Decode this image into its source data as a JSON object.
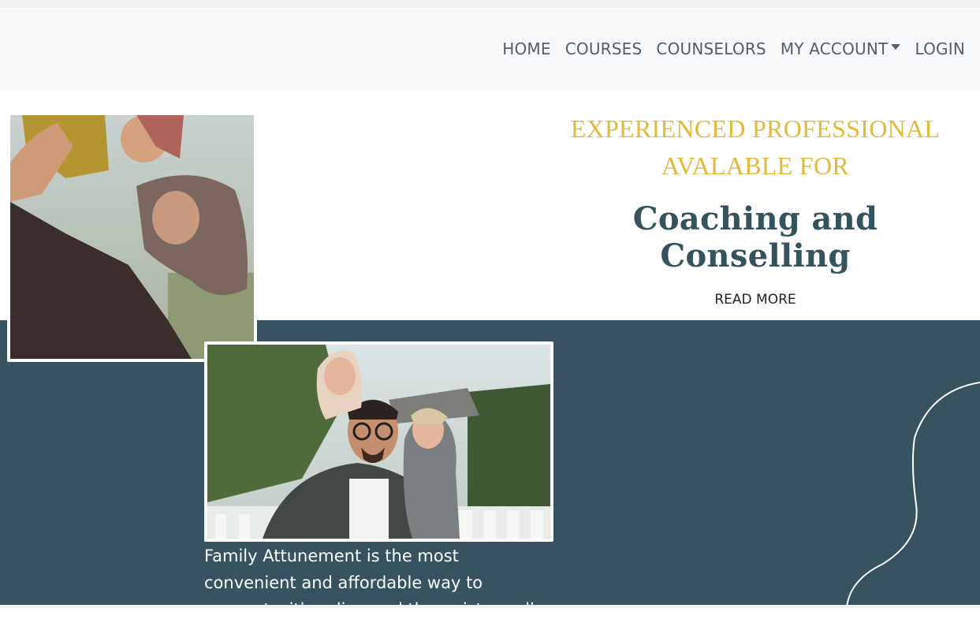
{
  "nav": {
    "items": [
      {
        "label": "HOME"
      },
      {
        "label": "COURSES"
      },
      {
        "label": "COUNSELORS"
      },
      {
        "label": "MY ACCOUNT"
      },
      {
        "label": "LOGIN"
      }
    ]
  },
  "hero": {
    "tagline_line1": "EXPERIENCED PROFESSIONAL",
    "tagline_line2": "AVALABLE FOR",
    "headline": "Coaching and Conselling",
    "read_more": "READ MORE"
  },
  "intro": {
    "line1": "Family Attunement is the most",
    "line2": "convenient and affordable way to",
    "line3": "connect with online and therapists, well"
  },
  "colors": {
    "navbar_bg": "#f8f9fa",
    "accent_gold": "#e2b93b",
    "headline": "#34535f",
    "teal_section": "#37535f"
  }
}
